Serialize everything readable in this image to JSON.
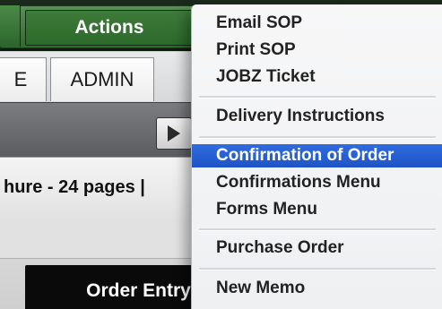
{
  "header": {
    "actions_label": "Actions"
  },
  "tabs": [
    {
      "label": "E"
    },
    {
      "label": "ADMIN"
    }
  ],
  "brochure_text": "hure  -  24 pages |",
  "order_entry_label": "Order Entry:",
  "menu": {
    "items": [
      {
        "label": "Email SOP"
      },
      {
        "label": "Print SOP"
      },
      {
        "label": "JOBZ Ticket"
      },
      {
        "label": "Delivery Instructions"
      },
      {
        "label": "Confirmation of Order"
      },
      {
        "label": "Confirmations Menu"
      },
      {
        "label": "Forms Menu"
      },
      {
        "label": "Purchase Order"
      },
      {
        "label": "New Memo"
      }
    ],
    "selected_index": 4
  },
  "colors": {
    "green_bar": "#2f6a2f",
    "selected_blue": "#2f6ce0",
    "order_entry_bg": "#0a0a0a"
  }
}
